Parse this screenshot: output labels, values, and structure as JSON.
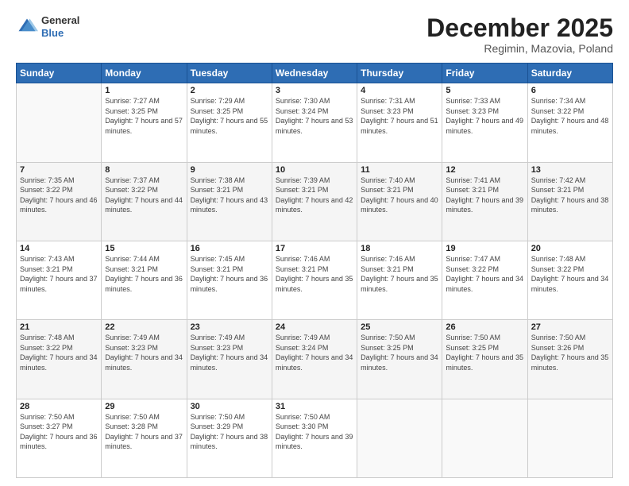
{
  "logo": {
    "general": "General",
    "blue": "Blue"
  },
  "header": {
    "month": "December 2025",
    "location": "Regimin, Mazovia, Poland"
  },
  "weekdays": [
    "Sunday",
    "Monday",
    "Tuesday",
    "Wednesday",
    "Thursday",
    "Friday",
    "Saturday"
  ],
  "weeks": [
    [
      {
        "day": "",
        "sunrise": "",
        "sunset": "",
        "daylight": ""
      },
      {
        "day": "1",
        "sunrise": "Sunrise: 7:27 AM",
        "sunset": "Sunset: 3:25 PM",
        "daylight": "Daylight: 7 hours and 57 minutes."
      },
      {
        "day": "2",
        "sunrise": "Sunrise: 7:29 AM",
        "sunset": "Sunset: 3:25 PM",
        "daylight": "Daylight: 7 hours and 55 minutes."
      },
      {
        "day": "3",
        "sunrise": "Sunrise: 7:30 AM",
        "sunset": "Sunset: 3:24 PM",
        "daylight": "Daylight: 7 hours and 53 minutes."
      },
      {
        "day": "4",
        "sunrise": "Sunrise: 7:31 AM",
        "sunset": "Sunset: 3:23 PM",
        "daylight": "Daylight: 7 hours and 51 minutes."
      },
      {
        "day": "5",
        "sunrise": "Sunrise: 7:33 AM",
        "sunset": "Sunset: 3:23 PM",
        "daylight": "Daylight: 7 hours and 49 minutes."
      },
      {
        "day": "6",
        "sunrise": "Sunrise: 7:34 AM",
        "sunset": "Sunset: 3:22 PM",
        "daylight": "Daylight: 7 hours and 48 minutes."
      }
    ],
    [
      {
        "day": "7",
        "sunrise": "Sunrise: 7:35 AM",
        "sunset": "Sunset: 3:22 PM",
        "daylight": "Daylight: 7 hours and 46 minutes."
      },
      {
        "day": "8",
        "sunrise": "Sunrise: 7:37 AM",
        "sunset": "Sunset: 3:22 PM",
        "daylight": "Daylight: 7 hours and 44 minutes."
      },
      {
        "day": "9",
        "sunrise": "Sunrise: 7:38 AM",
        "sunset": "Sunset: 3:21 PM",
        "daylight": "Daylight: 7 hours and 43 minutes."
      },
      {
        "day": "10",
        "sunrise": "Sunrise: 7:39 AM",
        "sunset": "Sunset: 3:21 PM",
        "daylight": "Daylight: 7 hours and 42 minutes."
      },
      {
        "day": "11",
        "sunrise": "Sunrise: 7:40 AM",
        "sunset": "Sunset: 3:21 PM",
        "daylight": "Daylight: 7 hours and 40 minutes."
      },
      {
        "day": "12",
        "sunrise": "Sunrise: 7:41 AM",
        "sunset": "Sunset: 3:21 PM",
        "daylight": "Daylight: 7 hours and 39 minutes."
      },
      {
        "day": "13",
        "sunrise": "Sunrise: 7:42 AM",
        "sunset": "Sunset: 3:21 PM",
        "daylight": "Daylight: 7 hours and 38 minutes."
      }
    ],
    [
      {
        "day": "14",
        "sunrise": "Sunrise: 7:43 AM",
        "sunset": "Sunset: 3:21 PM",
        "daylight": "Daylight: 7 hours and 37 minutes."
      },
      {
        "day": "15",
        "sunrise": "Sunrise: 7:44 AM",
        "sunset": "Sunset: 3:21 PM",
        "daylight": "Daylight: 7 hours and 36 minutes."
      },
      {
        "day": "16",
        "sunrise": "Sunrise: 7:45 AM",
        "sunset": "Sunset: 3:21 PM",
        "daylight": "Daylight: 7 hours and 36 minutes."
      },
      {
        "day": "17",
        "sunrise": "Sunrise: 7:46 AM",
        "sunset": "Sunset: 3:21 PM",
        "daylight": "Daylight: 7 hours and 35 minutes."
      },
      {
        "day": "18",
        "sunrise": "Sunrise: 7:46 AM",
        "sunset": "Sunset: 3:21 PM",
        "daylight": "Daylight: 7 hours and 35 minutes."
      },
      {
        "day": "19",
        "sunrise": "Sunrise: 7:47 AM",
        "sunset": "Sunset: 3:22 PM",
        "daylight": "Daylight: 7 hours and 34 minutes."
      },
      {
        "day": "20",
        "sunrise": "Sunrise: 7:48 AM",
        "sunset": "Sunset: 3:22 PM",
        "daylight": "Daylight: 7 hours and 34 minutes."
      }
    ],
    [
      {
        "day": "21",
        "sunrise": "Sunrise: 7:48 AM",
        "sunset": "Sunset: 3:22 PM",
        "daylight": "Daylight: 7 hours and 34 minutes."
      },
      {
        "day": "22",
        "sunrise": "Sunrise: 7:49 AM",
        "sunset": "Sunset: 3:23 PM",
        "daylight": "Daylight: 7 hours and 34 minutes."
      },
      {
        "day": "23",
        "sunrise": "Sunrise: 7:49 AM",
        "sunset": "Sunset: 3:23 PM",
        "daylight": "Daylight: 7 hours and 34 minutes."
      },
      {
        "day": "24",
        "sunrise": "Sunrise: 7:49 AM",
        "sunset": "Sunset: 3:24 PM",
        "daylight": "Daylight: 7 hours and 34 minutes."
      },
      {
        "day": "25",
        "sunrise": "Sunrise: 7:50 AM",
        "sunset": "Sunset: 3:25 PM",
        "daylight": "Daylight: 7 hours and 34 minutes."
      },
      {
        "day": "26",
        "sunrise": "Sunrise: 7:50 AM",
        "sunset": "Sunset: 3:25 PM",
        "daylight": "Daylight: 7 hours and 35 minutes."
      },
      {
        "day": "27",
        "sunrise": "Sunrise: 7:50 AM",
        "sunset": "Sunset: 3:26 PM",
        "daylight": "Daylight: 7 hours and 35 minutes."
      }
    ],
    [
      {
        "day": "28",
        "sunrise": "Sunrise: 7:50 AM",
        "sunset": "Sunset: 3:27 PM",
        "daylight": "Daylight: 7 hours and 36 minutes."
      },
      {
        "day": "29",
        "sunrise": "Sunrise: 7:50 AM",
        "sunset": "Sunset: 3:28 PM",
        "daylight": "Daylight: 7 hours and 37 minutes."
      },
      {
        "day": "30",
        "sunrise": "Sunrise: 7:50 AM",
        "sunset": "Sunset: 3:29 PM",
        "daylight": "Daylight: 7 hours and 38 minutes."
      },
      {
        "day": "31",
        "sunrise": "Sunrise: 7:50 AM",
        "sunset": "Sunset: 3:30 PM",
        "daylight": "Daylight: 7 hours and 39 minutes."
      },
      {
        "day": "",
        "sunrise": "",
        "sunset": "",
        "daylight": ""
      },
      {
        "day": "",
        "sunrise": "",
        "sunset": "",
        "daylight": ""
      },
      {
        "day": "",
        "sunrise": "",
        "sunset": "",
        "daylight": ""
      }
    ]
  ]
}
